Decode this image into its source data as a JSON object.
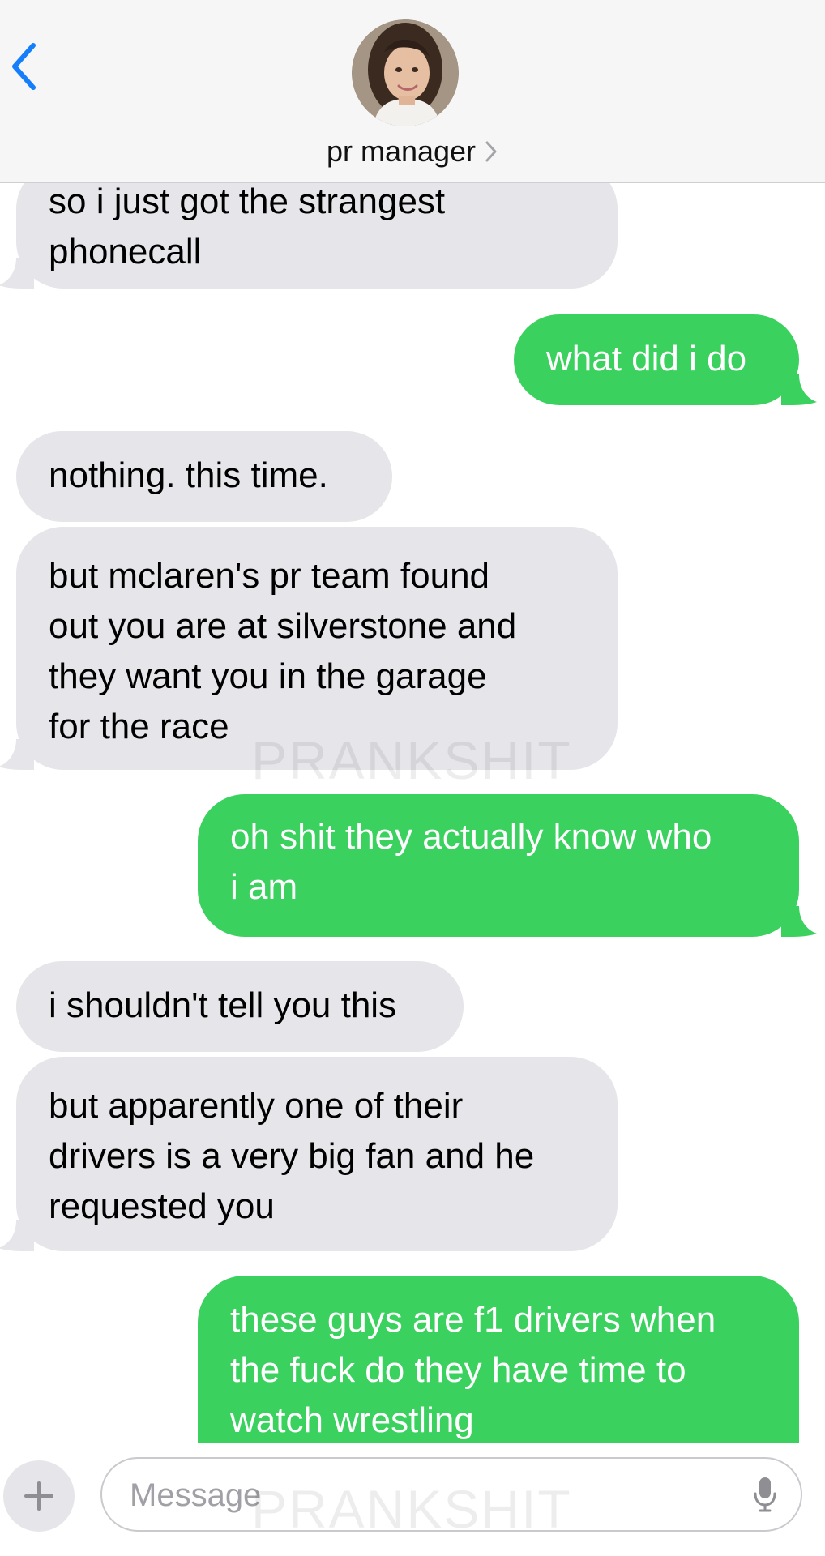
{
  "header": {
    "contact_name": "pr manager",
    "icons": {
      "back": "chevron-left-icon",
      "details": "chevron-right-icon"
    },
    "colors": {
      "accent": "#147efb"
    }
  },
  "messages": [
    {
      "direction": "incoming",
      "lines": [
        "so i just got the strangest",
        "phonecall"
      ]
    },
    {
      "direction": "outgoing",
      "lines": [
        "what did i do"
      ]
    },
    {
      "direction": "incoming",
      "lines": [
        "nothing. this time."
      ]
    },
    {
      "direction": "incoming",
      "lines": [
        "but mclaren's pr team found",
        "out you are at silverstone and",
        "they want you in the garage",
        "for the race"
      ]
    },
    {
      "direction": "outgoing",
      "lines": [
        "oh shit they actually know who",
        "i am"
      ]
    },
    {
      "direction": "incoming",
      "lines": [
        "i shouldn't tell you this"
      ]
    },
    {
      "direction": "incoming",
      "lines": [
        "but apparently one of their",
        "drivers is a very big fan and he",
        "requested you"
      ]
    },
    {
      "direction": "outgoing",
      "lines": [
        "these guys are f1 drivers when",
        "the fuck do they have time to",
        "watch wrestling"
      ]
    }
  ],
  "watermark": "PRANKSHIT",
  "composer": {
    "placeholder": "Message",
    "value": "",
    "icons": {
      "add": "plus-icon",
      "dictation": "microphone-icon"
    }
  },
  "colors": {
    "incoming_bubble": "#e5e5ea",
    "outgoing_bubble": "#3ad15e",
    "outgoing_text": "#ffffff"
  }
}
